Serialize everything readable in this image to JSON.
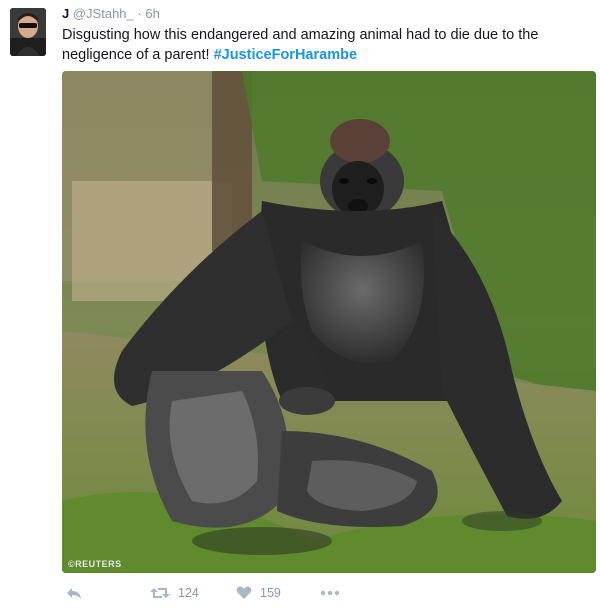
{
  "tweet": {
    "author_name": "J",
    "handle": "@JStahh_",
    "separator": "·",
    "time": "6h",
    "text": "Disgusting how this endangered and amazing animal had to die due to the negligence of a parent! ",
    "hashtag": "#JusticeForHarambe"
  },
  "media": {
    "credit": "©REUTERS",
    "subject": "gorilla-photo"
  },
  "actions": {
    "retweet_count": "124",
    "like_count": "159"
  },
  "colors": {
    "hashtag": "#1b95e0",
    "meta": "#8899a6",
    "icon": "#aab8c2"
  }
}
